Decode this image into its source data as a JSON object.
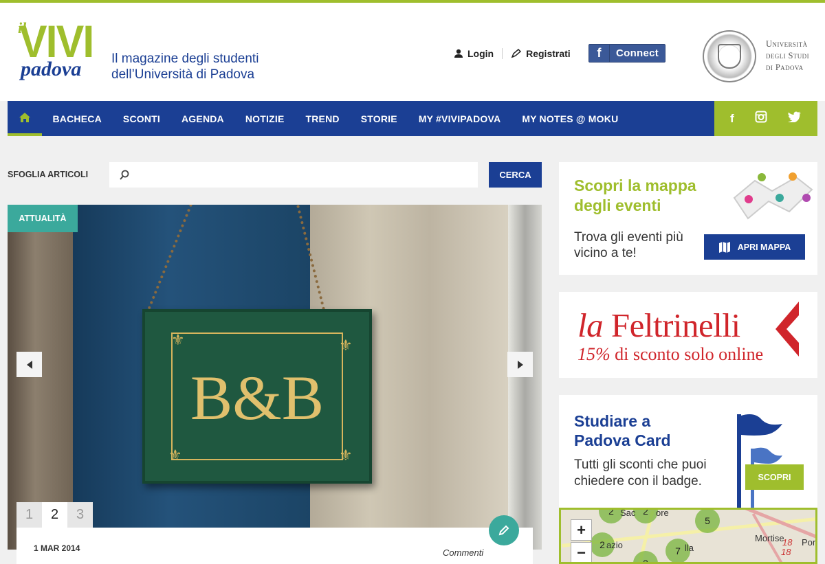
{
  "brand": {
    "logo_il": "il",
    "logo_vivi": "VIVI",
    "logo_padova": "padova",
    "tagline_line1": "Il magazine degli studenti",
    "tagline_line2": "dell’Università di Padova"
  },
  "user": {
    "login": "Login",
    "register": "Registrati",
    "fb_connect": "Connect"
  },
  "university": {
    "line1": "Università",
    "line2": "degli Studi",
    "line3": "di Padova"
  },
  "nav": {
    "items": [
      "BACHECA",
      "SCONTI",
      "AGENDA",
      "NOTIZIE",
      "TREND",
      "STORIE",
      "MY #VIVIPADOVA",
      "MY NOTES @ MOKU"
    ]
  },
  "social": [
    "facebook-icon",
    "instagram-icon",
    "twitter-icon"
  ],
  "search": {
    "label": "SFOGLIA ARTICOLI",
    "placeholder": "",
    "button": "CERCA"
  },
  "hero": {
    "category": "ATTUALITÀ",
    "sign_text": "B&B",
    "pages": [
      "1",
      "2",
      "3"
    ],
    "active_page": "2",
    "date": "1 MAR 2014",
    "comments": "Commenti"
  },
  "sidebar": {
    "events": {
      "title": "Scopri la mappa degli eventi",
      "subtitle": "Trova gli eventi più vicino a te!",
      "button": "APRI MAPPA"
    },
    "feltrinelli": {
      "brand_la": "la",
      "brand_name": "Feltrinelli",
      "promo_pct": "15%",
      "promo_rest": "di sconto solo online"
    },
    "card": {
      "title_line1": "Studiare a",
      "title_line2": "Padova Card",
      "subtitle": "Tutti gli sconti che puoi chiedere con il badge.",
      "button": "SCOPRI"
    },
    "map": {
      "zoom_in": "+",
      "zoom_out": "−",
      "clusters": [
        "2",
        "2",
        "5",
        "2",
        "7",
        "3"
      ],
      "labels": [
        "Sac",
        "ore",
        "Mortise",
        "azio",
        "lla",
        "18",
        "Pon",
        "18"
      ]
    }
  },
  "colors": {
    "brand_blue": "#1b3f94",
    "brand_green": "#9fbe2d",
    "teal": "#3ba99c",
    "feltrinelli_red": "#d0252b"
  }
}
